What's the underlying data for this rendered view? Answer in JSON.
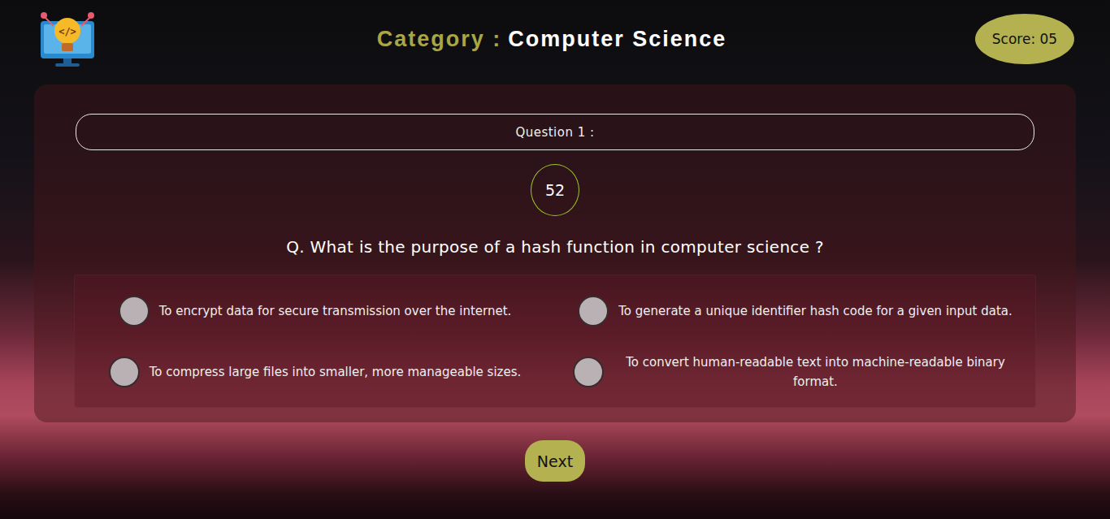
{
  "header": {
    "logo_text": "</>",
    "category_label": "Category :",
    "category_value": "Computer Science",
    "score": "Score: 05"
  },
  "question": {
    "label": "Question 1 :",
    "timer": "52",
    "text": "Q. What is the purpose of a hash function in computer science ?"
  },
  "options": [
    {
      "label": "To encrypt data for secure transmission over the internet.",
      "selected": false
    },
    {
      "label": "To generate a unique identifier hash code for a given input data.",
      "selected": false
    },
    {
      "label": "To compress large files into smaller, more manageable sizes.",
      "selected": false
    },
    {
      "label": "To convert human-readable text into machine-readable binary format.",
      "selected": false
    }
  ],
  "buttons": [
    "Next"
  ]
}
